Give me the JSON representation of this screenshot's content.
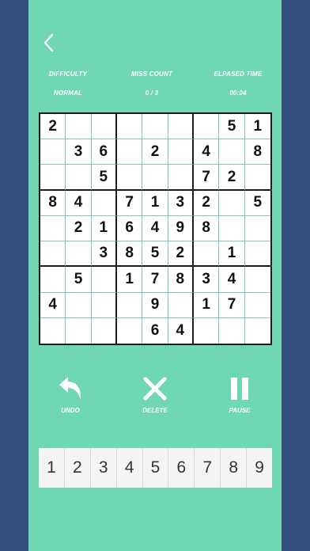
{
  "header": {
    "difficulty_label": "DIFFICULTY",
    "difficulty_value": "NORMAL",
    "miss_label": "MISS COUNT",
    "miss_value": "0 / 3",
    "time_label": "ELPASED TIME",
    "time_value": "00:04"
  },
  "board": [
    [
      "2",
      "",
      "",
      "",
      "",
      "",
      "",
      "5",
      "1"
    ],
    [
      "",
      "3",
      "6",
      "",
      "2",
      "",
      "4",
      "",
      "8"
    ],
    [
      "",
      "",
      "5",
      "",
      "",
      "",
      "7",
      "2",
      ""
    ],
    [
      "8",
      "4",
      "",
      "7",
      "1",
      "3",
      "2",
      "",
      "5"
    ],
    [
      "",
      "2",
      "1",
      "6",
      "4",
      "9",
      "8",
      "",
      ""
    ],
    [
      "",
      "",
      "3",
      "8",
      "5",
      "2",
      "",
      "1",
      ""
    ],
    [
      "",
      "5",
      "",
      "1",
      "7",
      "8",
      "3",
      "4",
      ""
    ],
    [
      "4",
      "",
      "",
      "",
      "9",
      "",
      "1",
      "7",
      ""
    ],
    [
      "",
      "",
      "",
      "",
      "6",
      "4",
      "",
      "",
      ""
    ]
  ],
  "tools": {
    "undo_label": "UNDO",
    "delete_label": "DELETE",
    "pause_label": "PAUSE"
  },
  "numbers": [
    "1",
    "2",
    "3",
    "4",
    "5",
    "6",
    "7",
    "8",
    "9"
  ],
  "colors": {
    "background": "#33507a",
    "panel": "#6fd8b2",
    "grid_line": "#7fcaa9"
  }
}
